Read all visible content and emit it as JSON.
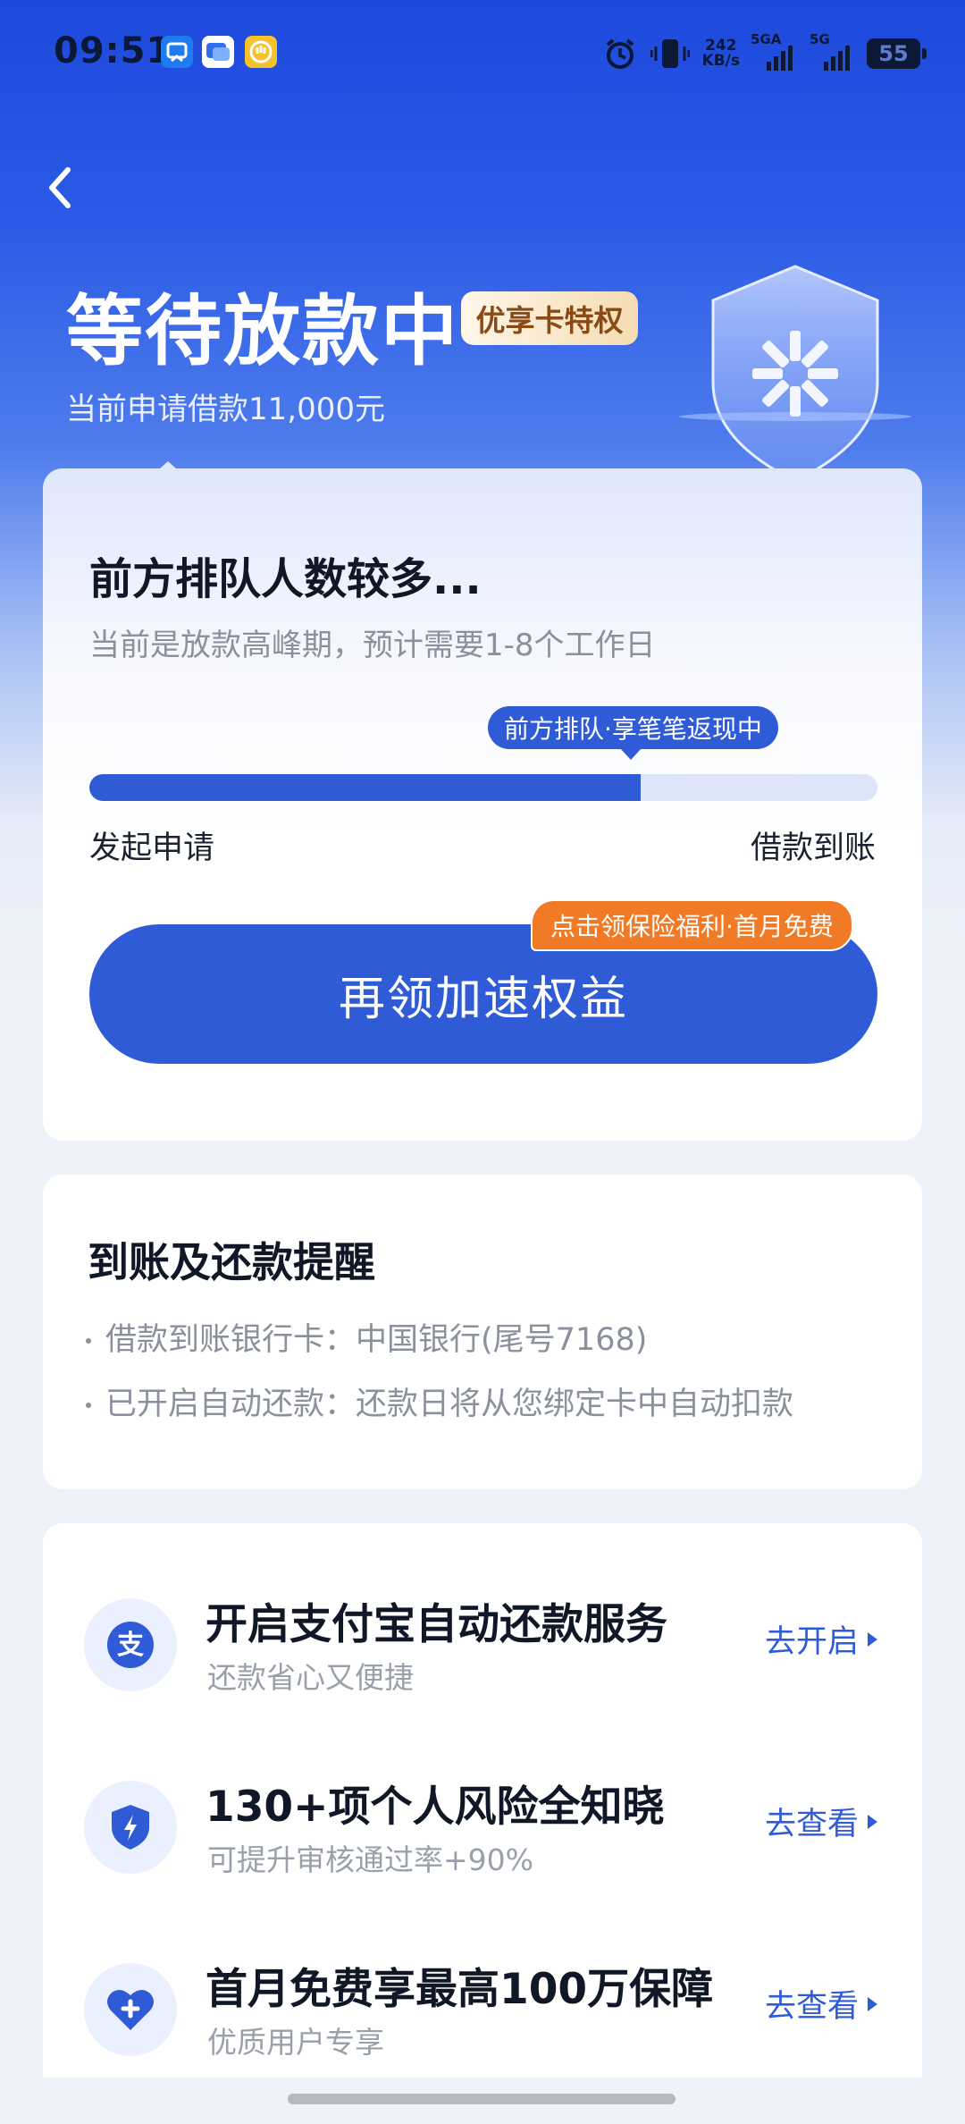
{
  "status_bar": {
    "time": "09:51",
    "speed_value": "242",
    "speed_unit": "KB/s",
    "sim1_label": "5GA",
    "sim2_label": "5G",
    "battery": "55"
  },
  "header": {
    "title": "等待放款中",
    "badge": "优享卡特权",
    "subtitle": "当前申请借款11,000元"
  },
  "progress_card": {
    "title": "前方排队人数较多...",
    "subtitle": "当前是放款高峰期，预计需要1-8个工作日",
    "tooltip": "前方排队·享笔笔返现中",
    "progress_fraction": 0.7,
    "start_label": "发起申请",
    "end_label": "借款到账",
    "cta_label": "再领加速权益",
    "cta_badge": "点击领保险福利·首月免费"
  },
  "reminder_card": {
    "title": "到账及还款提醒",
    "lines": [
      "借款到账银行卡：中国银行(尾号7168)",
      "已开启自动还款：还款日将从您绑定卡中自动扣款"
    ]
  },
  "services": [
    {
      "title": "开启支付宝自动还款服务",
      "subtitle": "还款省心又便捷",
      "action": "去开启",
      "icon": "alipay-icon"
    },
    {
      "title": "130+项个人风险全知晓",
      "subtitle": "可提升审核通过率+90%",
      "action": "去查看",
      "icon": "lightning-shield-icon"
    },
    {
      "title": "首月免费享最高100万保障",
      "subtitle": "优质用户专享",
      "action": "去查看",
      "icon": "heart-plus-icon"
    }
  ],
  "colors": {
    "primary": "#2f5bd6",
    "header_blue": "#1d49dc",
    "accent_orange": "#f07a26"
  }
}
